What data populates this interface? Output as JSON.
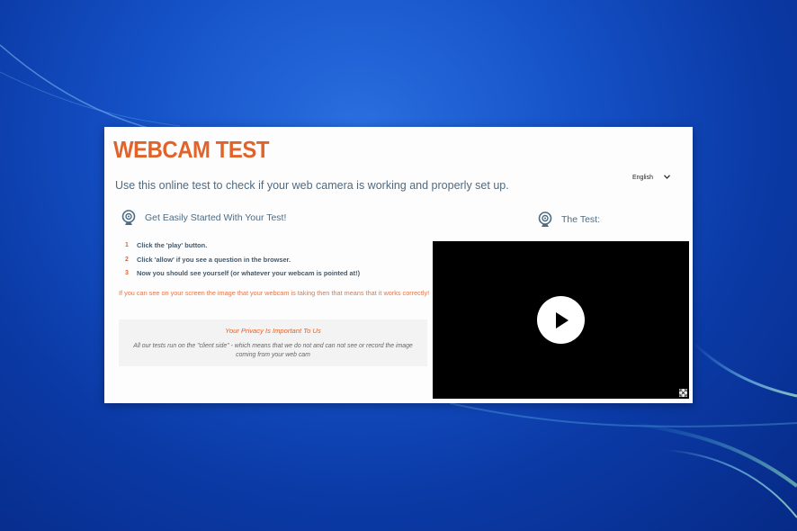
{
  "app": {
    "title": "WEBCAM TEST",
    "subtitle": "Use this online test to check if your web camera is working and properly set up.",
    "language": {
      "selected": "English"
    }
  },
  "intro": {
    "heading": "Get Easily Started With Your Test!",
    "steps": [
      {
        "num": "1",
        "text": "Click the 'play' button."
      },
      {
        "num": "2",
        "text": "Click 'allow' if you see a question in the browser."
      },
      {
        "num": "3",
        "text": "Now you should see yourself (or whatever your webcam is pointed at!)"
      }
    ],
    "note": "If you can see on your screen the image that your webcam is taking then that means that it works correctly!"
  },
  "privacy": {
    "heading": "Your Privacy Is Important To Us",
    "body": "All our tests run on the \"client side\" - which means that we do not and can not see or record the image coming from your web cam"
  },
  "test": {
    "heading": "The Test:"
  },
  "icons": {
    "webcam": "webcam-icon",
    "play": "play-icon",
    "fullscreen": "fullscreen-icon",
    "dropdown": "chevron-down-icon"
  },
  "colors": {
    "accent": "#e0632a",
    "text": "#4d6b82",
    "video_bg": "#000000",
    "privacy_bg": "#f3f3f4"
  }
}
